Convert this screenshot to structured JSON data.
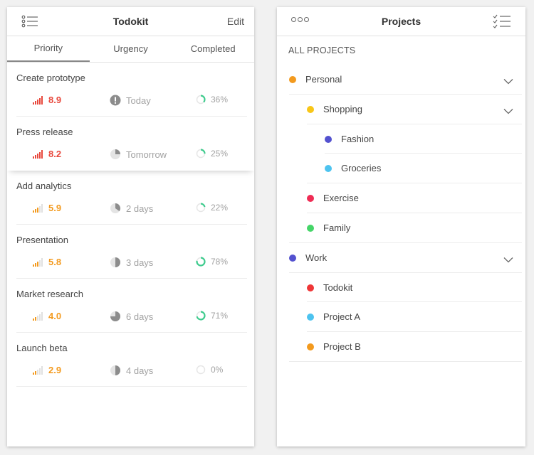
{
  "left_screen": {
    "title": "Todokit",
    "edit_label": "Edit",
    "tabs": [
      {
        "label": "Priority",
        "active": true
      },
      {
        "label": "Urgency",
        "active": false
      },
      {
        "label": "Completed",
        "active": false
      }
    ],
    "tasks": [
      {
        "name": "Create prototype",
        "priority": "8.9",
        "priority_level": 5,
        "priority_color": "#e8483c",
        "urgency_icon": "alert-circle-icon",
        "urgency": "Today",
        "completion": "36%",
        "completion_fraction": 0.36
      },
      {
        "name": "Press release",
        "priority": "8.2",
        "priority_level": 5,
        "priority_color": "#e8483c",
        "urgency_icon": "pie-clock-icon",
        "urgency_fraction": 0.25,
        "urgency": "Tomorrow",
        "completion": "25%",
        "completion_fraction": 0.25
      },
      {
        "name": "Add analytics",
        "priority": "5.9",
        "priority_level": 3,
        "priority_color": "#f39a1e",
        "urgency_icon": "pie-clock-icon",
        "urgency_fraction": 0.35,
        "urgency": "2 days",
        "completion": "22%",
        "completion_fraction": 0.22
      },
      {
        "name": "Presentation",
        "priority": "5.8",
        "priority_level": 3,
        "priority_color": "#f39a1e",
        "urgency_icon": "pie-clock-icon",
        "urgency_fraction": 0.5,
        "urgency": "3 days",
        "completion": "78%",
        "completion_fraction": 0.78
      },
      {
        "name": "Market research",
        "priority": "4.0",
        "priority_level": 2,
        "priority_color": "#f39a1e",
        "urgency_icon": "pie-clock-icon",
        "urgency_fraction": 0.75,
        "urgency": "6 days",
        "completion": "71%",
        "completion_fraction": 0.71
      },
      {
        "name": "Launch beta",
        "priority": "2.9",
        "priority_level": 2,
        "priority_color": "#f39a1e",
        "urgency_icon": "pie-clock-icon",
        "urgency_fraction": 0.5,
        "urgency": "4 days",
        "completion": "0%",
        "completion_fraction": 0
      }
    ]
  },
  "right_screen": {
    "title": "Projects",
    "section_label": "ALL PROJECTS",
    "projects": [
      {
        "name": "Personal",
        "color": "#f39a1e",
        "level": 0,
        "expandable": true
      },
      {
        "name": "Shopping",
        "color": "#f8c617",
        "level": 1,
        "expandable": true
      },
      {
        "name": "Fashion",
        "color": "#5351cf",
        "level": 2,
        "expandable": false
      },
      {
        "name": "Groceries",
        "color": "#4dc3ef",
        "level": 2,
        "expandable": false
      },
      {
        "name": "Exercise",
        "color": "#ef2c54",
        "level": 1,
        "expandable": false
      },
      {
        "name": "Family",
        "color": "#45d568",
        "level": 1,
        "expandable": false
      },
      {
        "name": "Work",
        "color": "#5351cf",
        "level": 0,
        "expandable": true
      },
      {
        "name": "Todokit",
        "color": "#ef3637",
        "level": 1,
        "expandable": false
      },
      {
        "name": "Project A",
        "color": "#4dc3ef",
        "level": 1,
        "expandable": false
      },
      {
        "name": "Project B",
        "color": "#f39a1e",
        "level": 1,
        "expandable": false
      }
    ]
  },
  "colors": {
    "completion_ring": "#3ecb8d",
    "ring_track": "#e6e6e6",
    "urgency_icon": "#8c8c8c"
  }
}
